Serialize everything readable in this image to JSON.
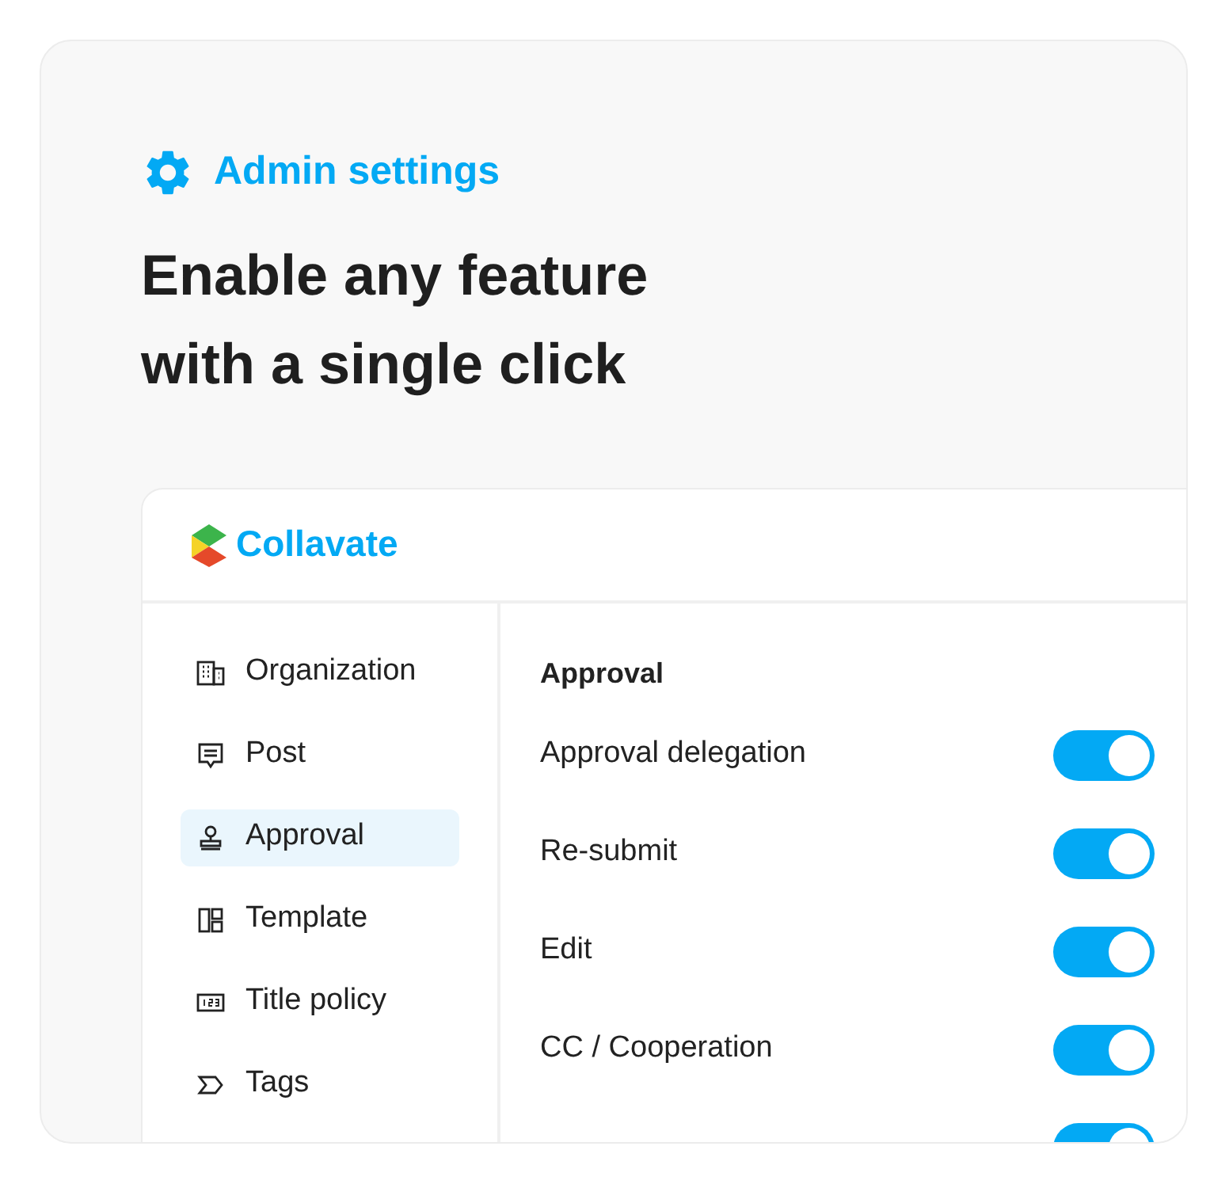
{
  "eyebrow": "Admin settings",
  "headline": [
    "Enable any feature",
    "with a single click"
  ],
  "app": {
    "brand": "Collavate",
    "sidebar": {
      "items": [
        {
          "label": "Organization",
          "kind": "building",
          "selected": false
        },
        {
          "label": "Post",
          "kind": "post",
          "selected": false
        },
        {
          "label": "Approval",
          "kind": "stamp",
          "selected": true
        },
        {
          "label": "Template",
          "kind": "layout",
          "selected": false
        },
        {
          "label": "Title policy",
          "kind": "numbers",
          "selected": false
        },
        {
          "label": "Tags",
          "kind": "tag",
          "selected": false
        }
      ]
    },
    "section_title": "Approval",
    "settings": [
      {
        "label": "Approval delegation",
        "on": true
      },
      {
        "label": "Re-submit",
        "on": true
      },
      {
        "label": "Edit",
        "on": true
      },
      {
        "label": "CC / Cooperation",
        "on": true
      },
      {
        "on": true
      }
    ]
  }
}
